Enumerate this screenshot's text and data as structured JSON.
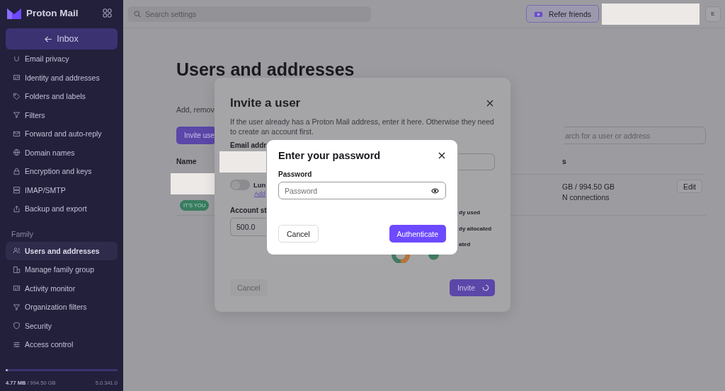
{
  "topbar": {
    "search": {
      "placeholder": "Search settings"
    },
    "refer_button": "Refer friends",
    "avatar": "E"
  },
  "sidebar": {
    "brand": "Proton Mail",
    "back_button": "Inbox",
    "groups": [
      {
        "items": [
          {
            "label": "Email privacy",
            "selected": false
          },
          {
            "label": "Identity and addresses",
            "selected": false
          },
          {
            "label": "Folders and labels",
            "selected": false
          },
          {
            "label": "Filters",
            "selected": false
          },
          {
            "label": "Forward and auto-reply",
            "selected": false
          },
          {
            "label": "Domain names",
            "selected": false
          },
          {
            "label": "Encryption and keys",
            "selected": false
          },
          {
            "label": "IMAP/SMTP",
            "selected": false
          },
          {
            "label": "Backup and export",
            "selected": false
          }
        ]
      },
      {
        "title": "Family",
        "items": [
          {
            "label": "Users and addresses",
            "selected": true
          },
          {
            "label": "Manage family group",
            "selected": false
          },
          {
            "label": "Activity monitor",
            "selected": false
          },
          {
            "label": "Organization filters",
            "selected": false
          },
          {
            "label": "Security",
            "selected": false
          },
          {
            "label": "Access control",
            "selected": false
          }
        ]
      }
    ],
    "storage": {
      "usage": "**4.77 MB** / 994.50 GB",
      "level": 0.02,
      "version": "5.0.341.0"
    }
  },
  "page": {
    "title": "Users and addresses",
    "description": "Add, remov",
    "invite_button": "Invite use",
    "search": {
      "placeholder": "arch for a user or address"
    },
    "columns": [
      "Name",
      "s"
    ],
    "rows": [
      {
        "badge": "IT'S YOU",
        "storage": "GB / 994.50 GB",
        "edit": "Edit",
        "connections": "N connections"
      }
    ]
  },
  "invite_dialog": {
    "title": "Invite a user",
    "description": "If the user already has a Proton Mail address, enter it here. Otherwise they need to create an account first.",
    "email_label": "Email addr",
    "toggle": {
      "label": "Lun",
      "on": false
    },
    "link": "Add",
    "storage_label": "Account st",
    "storage_value": "500.0",
    "legend": [
      "dy used",
      "dy allocated",
      "ated"
    ],
    "cancel": "Cancel",
    "invite": "Invite"
  },
  "password_dialog": {
    "title": "Enter your password",
    "label": "Password",
    "placeholder": "Password",
    "cancel": "Cancel",
    "submit": "Authenticate"
  }
}
